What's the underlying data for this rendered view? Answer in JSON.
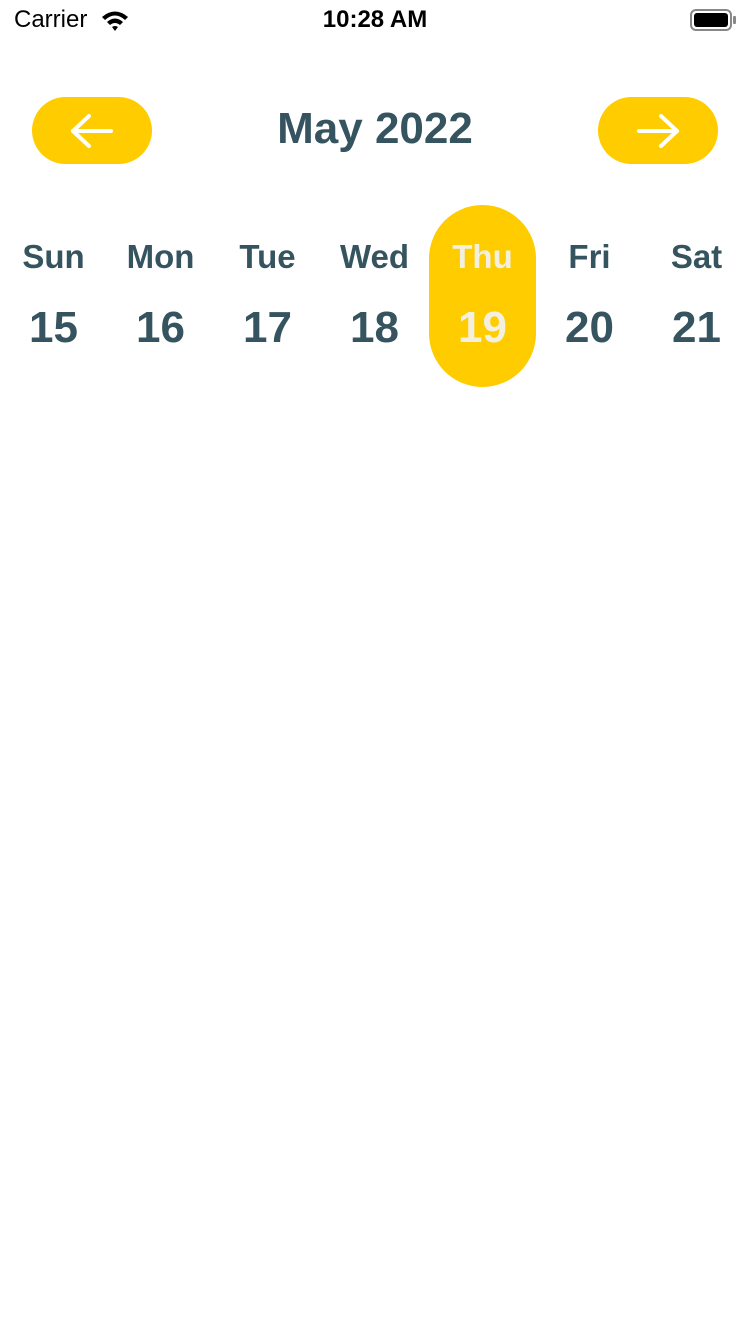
{
  "status_bar": {
    "carrier": "Carrier",
    "time": "10:28 AM",
    "wifi_icon": "wifi-icon",
    "battery_icon": "battery-icon"
  },
  "header": {
    "title": "May 2022",
    "prev_icon": "arrow-left-icon",
    "next_icon": "arrow-right-icon"
  },
  "week": {
    "selected_index": 4,
    "days": [
      {
        "name": "Sun",
        "num": "15"
      },
      {
        "name": "Mon",
        "num": "16"
      },
      {
        "name": "Tue",
        "num": "17"
      },
      {
        "name": "Wed",
        "num": "18"
      },
      {
        "name": "Thu",
        "num": "19"
      },
      {
        "name": "Fri",
        "num": "20"
      },
      {
        "name": "Sat",
        "num": "21"
      }
    ]
  },
  "colors": {
    "accent": "#ffcc00",
    "text": "#35545f",
    "selected_text": "#f3f0e0",
    "background": "#ffffff"
  }
}
